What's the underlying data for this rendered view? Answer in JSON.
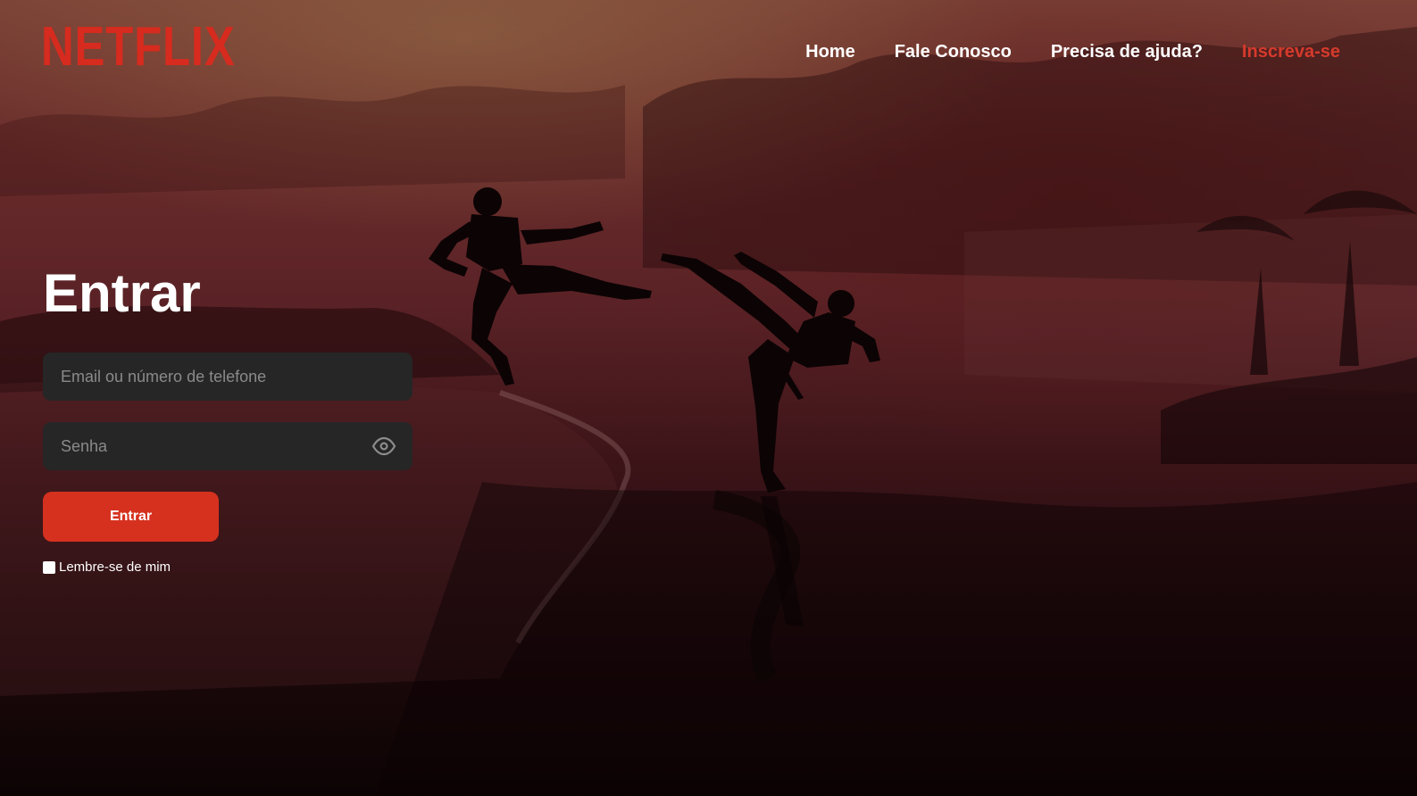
{
  "brand": {
    "logo_text": "NETFLIX",
    "accent_color": "#d62b1e"
  },
  "nav": {
    "items": [
      {
        "label": "Home"
      },
      {
        "label": "Fale Conosco"
      },
      {
        "label": "Precisa de ajuda?"
      },
      {
        "label": "Inscreva-se"
      }
    ]
  },
  "login": {
    "title": "Entrar",
    "email_placeholder": "Email ou número de telefone",
    "password_placeholder": "Senha",
    "submit_label": "Entrar",
    "remember_label": "Lembre-se de mim",
    "remember_checked": false
  },
  "icons": {
    "show_password": "eye-icon"
  },
  "colors": {
    "button": "#d6311f",
    "field_bg": "#262626",
    "nav_accent": "#d63a2c"
  }
}
